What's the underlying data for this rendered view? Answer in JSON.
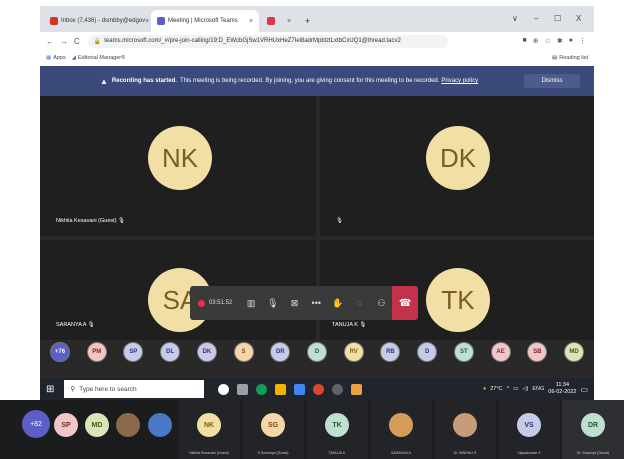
{
  "browser": {
    "tabs": [
      {
        "title": "Inbox (7,436) - dsmbby@edgov",
        "icon_color": "#d93025",
        "active": false
      },
      {
        "title": "Meeting | Microsoft Teams",
        "icon_color": "#5b5fc7",
        "active": true
      },
      {
        "title": "",
        "icon_color": "#e0334c",
        "active": false
      }
    ],
    "new_tab": "+",
    "window_controls": [
      "∨",
      "–",
      "☐",
      "X"
    ],
    "url": "teams.microsoft.com/_#/pre-join-calling/19:D_EWcbGjSw1VRHUxHeZ7Iel8adrMpblztLxtbCxUQ1@thread.tacv2",
    "bookmarks": [
      "Apps",
      "Editorial Manager®"
    ],
    "reading_list": "Reading list"
  },
  "teams": {
    "banner": {
      "bold": "Recording has started.",
      "text": "This meeting is being recorded. By joining, you are giving consent for this meeting to be recorded.",
      "link": "Privacy policy",
      "dismiss": "Dismiss"
    },
    "tiles": [
      {
        "initials": "NK",
        "label": "Nikhila Kesavani (Guest)"
      },
      {
        "initials": "DK",
        "label": ""
      },
      {
        "initials": "SA",
        "label": "SARANYA A"
      },
      {
        "initials": "TK",
        "label": "TANUJA K"
      }
    ],
    "controls": {
      "timer": "03:51:52"
    },
    "participants": [
      {
        "initials": "+76",
        "bg": "#5b5fc7",
        "fg": "#ffffff"
      },
      {
        "initials": "PM",
        "bg": "#f2c6c6",
        "fg": "#6b2a2a"
      },
      {
        "initials": "SP",
        "bg": "#c8cbe8",
        "fg": "#2f3277"
      },
      {
        "initials": "DL",
        "bg": "#c8cbe8",
        "fg": "#2f3277"
      },
      {
        "initials": "DK",
        "bg": "#c8cbe8",
        "fg": "#2f3277"
      },
      {
        "initials": "S",
        "bg": "#f5d6a8",
        "fg": "#7a4a14"
      },
      {
        "initials": "DR",
        "bg": "#c8cbe8",
        "fg": "#2f3277"
      },
      {
        "initials": "D",
        "bg": "#bfe0cf",
        "fg": "#1f5a3e"
      },
      {
        "initials": "RV",
        "bg": "#f1dfa5",
        "fg": "#7a5f1e"
      },
      {
        "initials": "RB",
        "bg": "#c8cbe8",
        "fg": "#2f3277"
      },
      {
        "initials": "D",
        "bg": "#c8cbe8",
        "fg": "#2f3277"
      },
      {
        "initials": "ST",
        "bg": "#bfe0cf",
        "fg": "#1f5a3e"
      },
      {
        "initials": "AE",
        "bg": "#f2c6c6",
        "fg": "#6b2a2a"
      },
      {
        "initials": "SB",
        "bg": "#f2c6c6",
        "fg": "#6b2a2a"
      },
      {
        "initials": "MD",
        "bg": "#dbe6b8",
        "fg": "#4a5a14"
      }
    ]
  },
  "taskbar": {
    "search_placeholder": "Type here to search",
    "weather": "27°C",
    "lang": "ENG",
    "time": "11:34",
    "date": "06-02-2022"
  },
  "strip": {
    "plus": "+82",
    "small": [
      {
        "initials": "SP",
        "bg": "#f2c6c6",
        "fg": "#6b2a2a"
      },
      {
        "initials": "MD",
        "bg": "#dbe6b8",
        "fg": "#4a5a14"
      }
    ],
    "tiles": [
      {
        "initials": "NK",
        "label": "Nikhila Kesavani (Guest)",
        "bg": "#f1dfa5",
        "fg": "#7a5f1e"
      },
      {
        "initials": "SG",
        "label": "S Sowmiya (Guest)",
        "bg": "#f5d6a8",
        "fg": "#7a4a14"
      },
      {
        "initials": "TK",
        "label": "TANUJA K",
        "bg": "#bfe0cf",
        "fg": "#1f5a3e"
      },
      {
        "initials": "",
        "label": "SARANYA A",
        "bg": "#d79b5b",
        "fg": "#ffffff"
      },
      {
        "initials": "",
        "label": "Dr. BINDHU S",
        "bg": "#c69c7a",
        "fg": "#ffffff"
      },
      {
        "initials": "VS",
        "label": "Vijayakumar S",
        "bg": "#c8cbe8",
        "fg": "#2f3277"
      },
      {
        "initials": "DR",
        "label": "Dr. Sowmya (Guest)",
        "bg": "#bfe0cf",
        "fg": "#1f5a3e"
      }
    ]
  }
}
